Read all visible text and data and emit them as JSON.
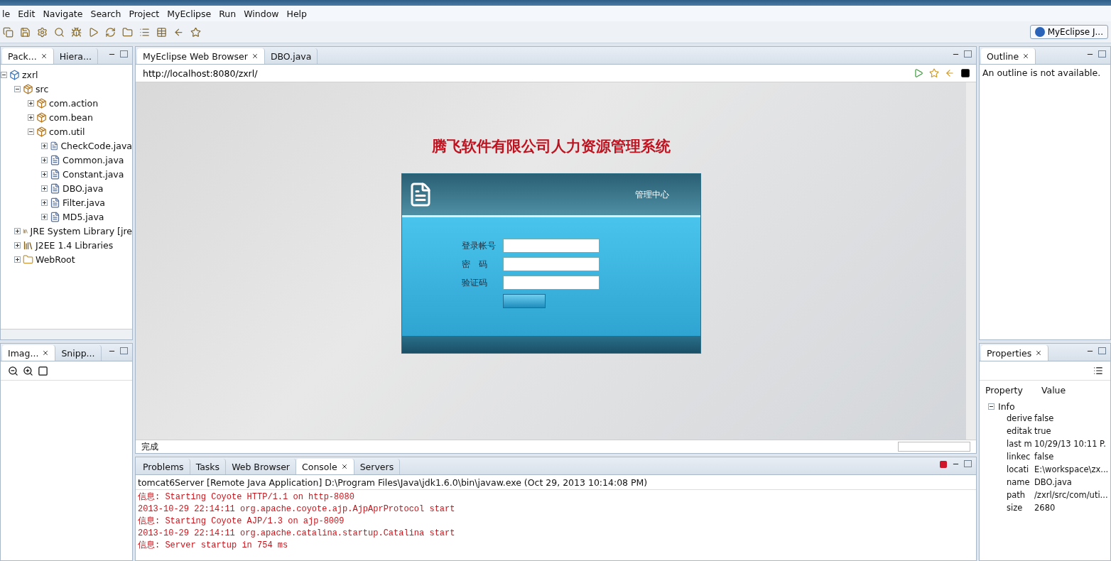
{
  "menu": [
    "le",
    "Edit",
    "Navigate",
    "Search",
    "Project",
    "MyEclipse",
    "Run",
    "Window",
    "Help"
  ],
  "perspective": {
    "label": "MyEclipse J..."
  },
  "left_top": {
    "tabs": [
      {
        "label": "Pack...",
        "selected": true
      },
      {
        "label": "Hiera...",
        "selected": false
      }
    ],
    "tree": [
      {
        "label": "zxrl",
        "kind": "project",
        "expanded": true,
        "children": [
          {
            "label": "src",
            "kind": "source",
            "expanded": true,
            "children": [
              {
                "label": "com.action",
                "kind": "package",
                "expanded": false
              },
              {
                "label": "com.bean",
                "kind": "package",
                "expanded": false
              },
              {
                "label": "com.util",
                "kind": "package",
                "expanded": true,
                "children": [
                  {
                    "label": "CheckCode.java",
                    "kind": "file",
                    "expanded": false
                  },
                  {
                    "label": "Common.java",
                    "kind": "file",
                    "expanded": false
                  },
                  {
                    "label": "Constant.java",
                    "kind": "file",
                    "expanded": false
                  },
                  {
                    "label": "DBO.java",
                    "kind": "file",
                    "expanded": false
                  },
                  {
                    "label": "Filter.java",
                    "kind": "file",
                    "expanded": false
                  },
                  {
                    "label": "MD5.java",
                    "kind": "file",
                    "expanded": false
                  }
                ]
              }
            ]
          },
          {
            "label": "JRE System Library [jre",
            "kind": "library",
            "expanded": false
          },
          {
            "label": "J2EE 1.4 Libraries",
            "kind": "library",
            "expanded": false
          },
          {
            "label": "WebRoot",
            "kind": "folder",
            "expanded": false
          }
        ]
      }
    ]
  },
  "left_bottom": {
    "tabs": [
      {
        "label": "Imag...",
        "selected": true
      },
      {
        "label": "Snipp...",
        "selected": false
      }
    ]
  },
  "editor": {
    "tabs": [
      {
        "label": "MyEclipse Web Browser",
        "selected": true
      },
      {
        "label": "DBO.java",
        "selected": false
      }
    ],
    "url": "http://localhost:8080/zxrl/",
    "page": {
      "title": "腾飞软件有限公司人力资源管理系统",
      "header": "管理中心",
      "fields": [
        {
          "label": "登录帐号"
        },
        {
          "label": "密　码"
        },
        {
          "label": "验证码"
        }
      ]
    },
    "status": "完成"
  },
  "console": {
    "tabs": [
      {
        "label": "Problems",
        "selected": false
      },
      {
        "label": "Tasks",
        "selected": false
      },
      {
        "label": "Web Browser",
        "selected": false
      },
      {
        "label": "Console",
        "selected": true
      },
      {
        "label": "Servers",
        "selected": false
      }
    ],
    "header": "tomcat6Server [Remote Java Application] D:\\Program Files\\Java\\jdk1.6.0\\bin\\javaw.exe (Oct 29, 2013 10:14:08 PM)",
    "lines": [
      "信息: Starting Coyote HTTP/1.1 on http-8080",
      "2013-10-29 22:14:11 org.apache.coyote.ajp.AjpAprProtocol start",
      "信息: Starting Coyote AJP/1.3 on ajp-8009",
      "2013-10-29 22:14:11 org.apache.catalina.startup.Catalina start",
      "信息: Server startup in 754 ms"
    ]
  },
  "outline": {
    "tab": "Outline",
    "message": "An outline is not available."
  },
  "properties": {
    "tab": "Properties",
    "columns": [
      "Property",
      "Value"
    ],
    "group": "Info",
    "rows": [
      {
        "key": "derive",
        "value": "false"
      },
      {
        "key": "editak",
        "value": "true"
      },
      {
        "key": "last m",
        "value": "10/29/13 10:11 P."
      },
      {
        "key": "linkec",
        "value": "false"
      },
      {
        "key": "locati",
        "value": "E:\\workspace\\zx..."
      },
      {
        "key": "name",
        "value": "DBO.java"
      },
      {
        "key": "path",
        "value": "/zxrl/src/com/uti..."
      },
      {
        "key": "size",
        "value": "2680"
      }
    ]
  }
}
